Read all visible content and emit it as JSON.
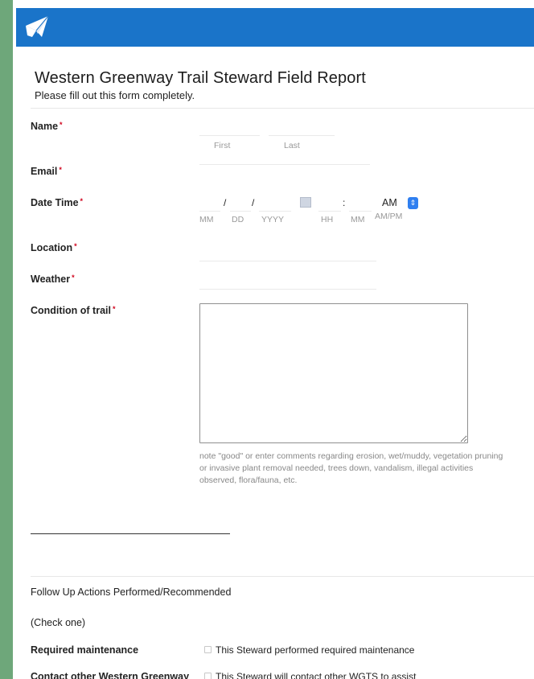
{
  "form": {
    "title": "Western Greenway Trail Steward Field Report",
    "subtitle": "Please fill out this form completely."
  },
  "fields": {
    "name": {
      "label": "Name",
      "first_sub": "First",
      "last_sub": "Last",
      "first_value": "",
      "last_value": ""
    },
    "email": {
      "label": "Email",
      "value": ""
    },
    "datetime": {
      "label": "Date Time",
      "sep_slash": "/",
      "sep_colon": ":",
      "ampm_value": "AM",
      "sub_mm": "MM",
      "sub_dd": "DD",
      "sub_yyyy": "YYYY",
      "sub_hh": "HH",
      "sub_min": "MM",
      "sub_ampm": "AM/PM"
    },
    "location": {
      "label": "Location",
      "value": ""
    },
    "weather": {
      "label": "Weather",
      "value": ""
    },
    "condition": {
      "label": "Condition of trail",
      "value": "",
      "note": "note \"good\" or enter comments regarding erosion, wet/muddy, vegetation pruning or invasive plant removal needed, trees down, vandalism, illegal activities observed, flora/fauna, etc."
    },
    "required_star": "*"
  },
  "followup": {
    "heading": "Follow Up Actions Performed/Recommended",
    "instruction": "(Check one)",
    "options": [
      {
        "label": "Required maintenance",
        "check_label": "This Steward performed required maintenance"
      },
      {
        "label": "Contact other Western Greenway",
        "check_label": "This Steward will contact other WGTS to assist"
      }
    ]
  },
  "icons": {
    "logo": "envelope-plane-logo",
    "calendar": "calendar-icon",
    "select": "select-arrows-icon"
  },
  "colors": {
    "header": "#1a74c9",
    "required": "#d0021b",
    "frame": "#6ea77a"
  }
}
